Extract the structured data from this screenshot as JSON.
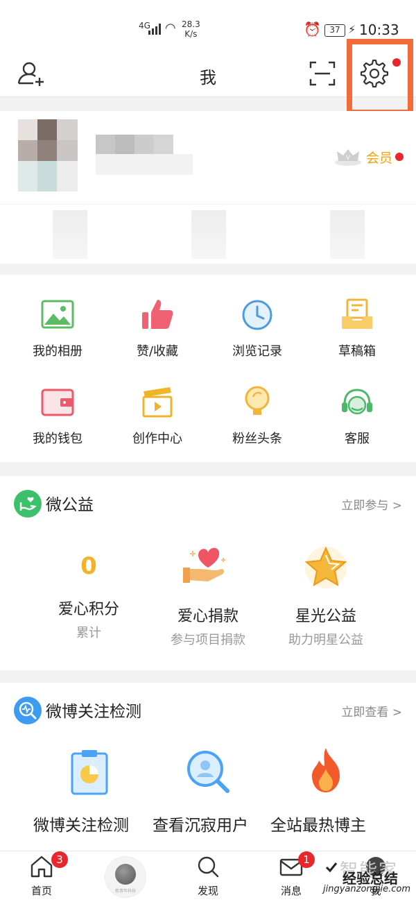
{
  "status_bar": {
    "network": "4G",
    "speed_top": "28.3",
    "speed_bottom": "K/s",
    "battery": "37",
    "time": "10:33"
  },
  "header": {
    "title": "我",
    "left_icon": "add-friend-icon",
    "scan_icon": "scan-icon",
    "settings_icon": "gear-icon",
    "settings_has_dot": true
  },
  "profile": {
    "vip_label": "会员",
    "vip_icon": "crown-icon"
  },
  "grid": {
    "items": [
      {
        "label": "我的相册",
        "icon": "photo-album-icon"
      },
      {
        "label": "赞/收藏",
        "icon": "thumbs-up-icon"
      },
      {
        "label": "浏览记录",
        "icon": "history-clock-icon"
      },
      {
        "label": "草稿箱",
        "icon": "drafts-tray-icon"
      },
      {
        "label": "我的钱包",
        "icon": "wallet-icon"
      },
      {
        "label": "创作中心",
        "icon": "clapperboard-icon"
      },
      {
        "label": "粉丝头条",
        "icon": "lightbulb-icon"
      },
      {
        "label": "客服",
        "icon": "headset-icon"
      }
    ]
  },
  "charity": {
    "title": "微公益",
    "action": "立即参与 >",
    "items": [
      {
        "value": "0",
        "title": "爱心积分",
        "subtitle": "累计"
      },
      {
        "title": "爱心捐款",
        "subtitle": "参与项目捐款",
        "icon": "heart-hand-icon"
      },
      {
        "title": "星光公益",
        "subtitle": "助力明星公益",
        "icon": "star-icon"
      }
    ]
  },
  "follow_check": {
    "title": "微博关注检测",
    "action": "立即查看 >",
    "items": [
      {
        "title": "微博关注检测",
        "icon": "clipboard-icon"
      },
      {
        "title": "查看沉寂用户",
        "icon": "user-search-icon"
      },
      {
        "title": "全站最热博主",
        "icon": "flame-icon"
      }
    ]
  },
  "tabbar": {
    "tabs": [
      {
        "label": "首页",
        "icon": "home-icon",
        "badge": "3"
      },
      {
        "label": "",
        "icon": "center-globe-icon",
        "sublabel": "新青年科技"
      },
      {
        "label": "发现",
        "icon": "search-icon"
      },
      {
        "label": "消息",
        "icon": "mail-icon",
        "badge": "1"
      },
      {
        "label": "我",
        "icon": "profile-icon"
      }
    ]
  },
  "watermark": {
    "text_top": "智能家",
    "text_cn": "经验总结",
    "text_url": "jingyanzongjie.com"
  },
  "colors": {
    "accent_red": "#e8262b",
    "vip_orange": "#f5a20b",
    "highlight_border": "#f26b3a",
    "score_yellow": "#f5b323"
  }
}
